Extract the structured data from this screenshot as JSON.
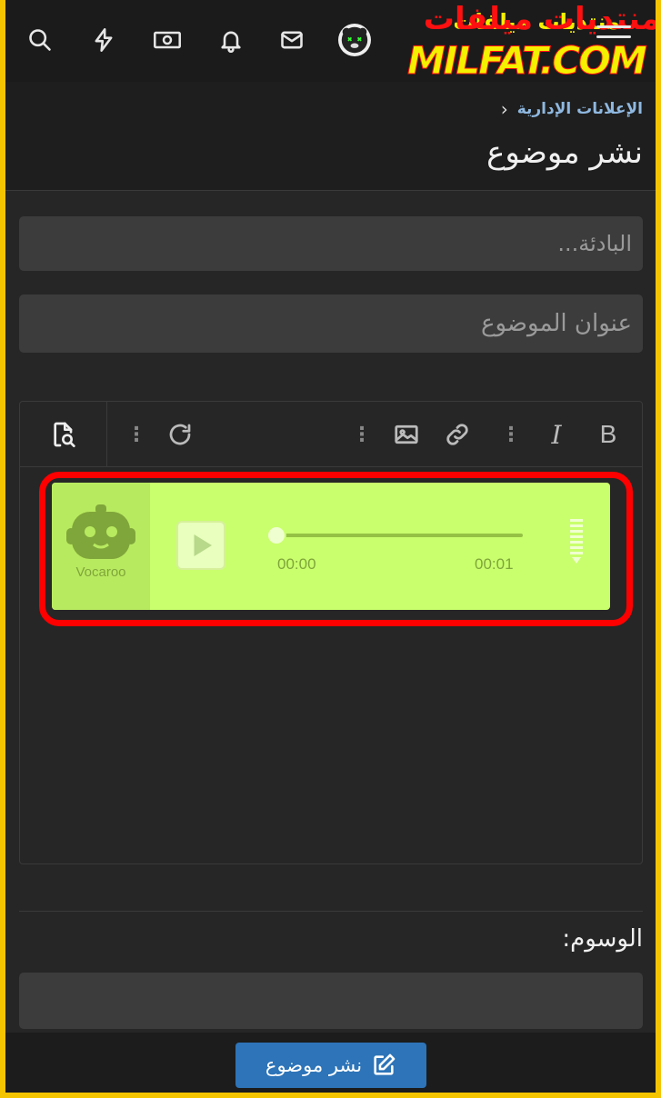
{
  "topbar": {
    "icons": [
      "search-icon",
      "bolt-icon",
      "money-icon",
      "bell-icon",
      "mail-icon",
      "avatar",
      "menu-icon"
    ],
    "logo_arabic": "منتديات ميلفات",
    "logo_latin": "MILFAT.COM"
  },
  "header": {
    "breadcrumb": "الإعلانات الإدارية",
    "title": "نشر موضوع"
  },
  "form": {
    "prefix_placeholder": "البادئة...",
    "title_placeholder": "عنوان الموضوع",
    "tags_label": "الوسوم:",
    "tags_value": "",
    "submit_label": "نشر موضوع"
  },
  "editor": {
    "toolbar": [
      "bold-icon",
      "italic-icon",
      "more-icon",
      "link-icon",
      "image-icon",
      "more-icon",
      "redo-icon",
      "more-icon",
      "preview-icon"
    ],
    "embed": {
      "brand": "Vocaroo",
      "time_current": "00:00",
      "time_total": "00:01",
      "progress": 0,
      "highlight_color": "#ff0000",
      "player_color": "#c9ff6d"
    }
  }
}
